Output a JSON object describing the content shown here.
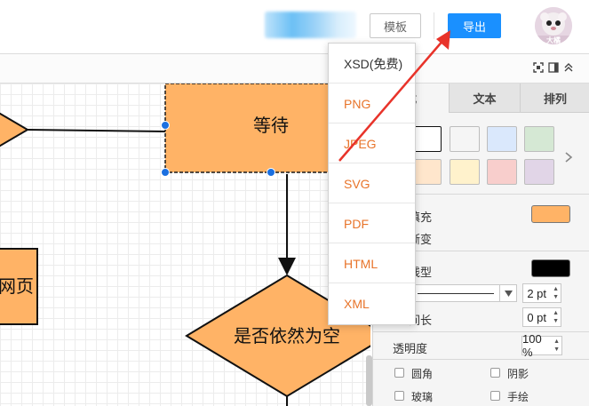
{
  "header": {
    "template_label": "模板",
    "export_label": "导出",
    "avatar_text": "大橘"
  },
  "export_menu": {
    "items": [
      "XSD(免费)",
      "PNG",
      "JPEG",
      "SVG",
      "PDF",
      "HTML",
      "XML"
    ]
  },
  "canvas": {
    "node_wait": "等待",
    "node_decision": "是否依然为空",
    "node_page": "网页"
  },
  "panel": {
    "tabs": [
      "式",
      "文本",
      "排列"
    ],
    "fill_label": "填充",
    "gradient_label": "渐变",
    "line_label": "线型",
    "line_width": "2 pt",
    "length_label": "间长",
    "length_value": "0 pt",
    "opacity_label": "透明度",
    "opacity_value": "100 %",
    "rounded_label": "圆角",
    "shadow_label": "阴影",
    "glass_label": "玻璃",
    "sketch_label": "手绘"
  },
  "colors": {
    "accent": "#1a90ff",
    "shape_fill": "#ffb366",
    "menu_text": "#e8742a",
    "arrow": "#e8332a",
    "swatches_row1": [
      "#ffffff",
      "#f5f5f5",
      "#dae8fc",
      "#d5e8d4"
    ],
    "swatches_row2": [
      "#ffe6cc",
      "#fff2cc",
      "#f8cecc",
      "#e1d5e7"
    ]
  }
}
